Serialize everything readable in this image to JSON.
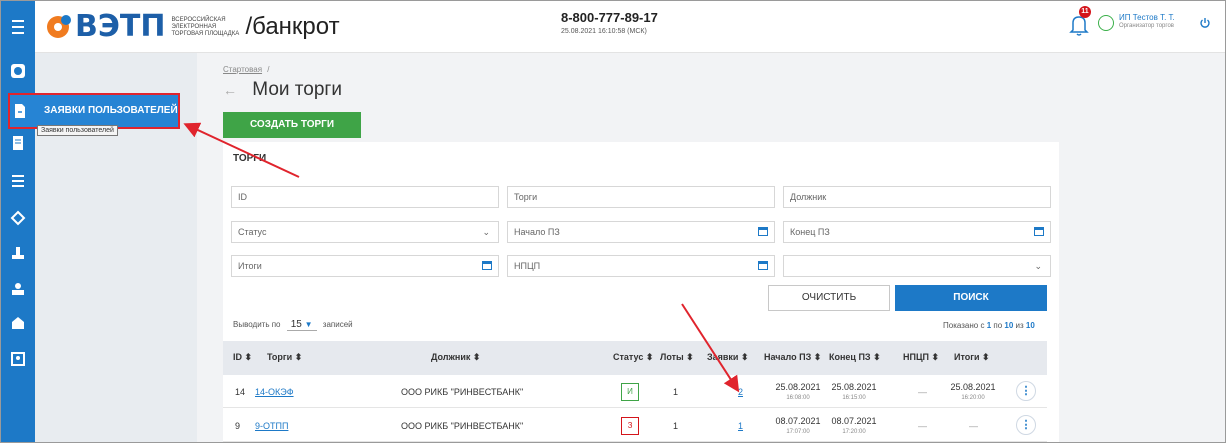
{
  "header": {
    "logo_word": "ВЭТП",
    "logo_sub_1": "Всероссийская",
    "logo_sub_2": "электронная",
    "logo_sub_3": "торговая площадка",
    "logo_suffix": "/банкрот",
    "phone": "8-800-777-89-17",
    "datetime": "25.08.2021 16:10:58 (МСК)",
    "notifications_count": "11",
    "user_name": "ИП Тестов Т. Т.",
    "user_role": "Организатор торгов"
  },
  "sidebar": {
    "icons": [
      "logo-icon",
      "file-icon",
      "document-icon",
      "list-icon",
      "gavel-icon",
      "auction-icon",
      "auction-alt-icon",
      "building-icon",
      "contacts-icon"
    ],
    "active_item_label": "ЗАЯВКИ ПОЛЬЗОВАТЕЛЕЙ",
    "tooltip": "Заявки пользователей"
  },
  "breadcrumb": {
    "home": "Стартовая",
    "separator": "/"
  },
  "page": {
    "back_icon": "arrow-left-icon",
    "title": "Мои торги",
    "create_button": "Создать торги"
  },
  "filters": {
    "section_title": "ТОРГИ",
    "id_placeholder": "ID",
    "torgi_placeholder": "Торги",
    "debtor_placeholder": "Должник",
    "status_placeholder": "Статус",
    "start_pz_placeholder": "Начало ПЗ",
    "end_pz_placeholder": "Конец ПЗ",
    "results_placeholder": "Итоги",
    "npcp_placeholder": "НПЦП",
    "clear_button": "ОЧИСТИТЬ",
    "search_button": "ПОИСК"
  },
  "table_controls": {
    "show_prefix": "Выводить по",
    "per_page": "15",
    "show_suffix": "записей",
    "shown_prefix": "Показано с",
    "shown_from": "1",
    "shown_mid": "по",
    "shown_to": "10",
    "shown_of": "из",
    "shown_total": "10"
  },
  "table": {
    "columns": [
      "ID ⬍",
      "Торги ⬍",
      "Должник ⬍",
      "Статус ⬍",
      "Лоты ⬍",
      "Заявки ⬍",
      "Начало ПЗ ⬍",
      "Конец ПЗ ⬍",
      "НПЦП ⬍",
      "Итоги ⬍"
    ],
    "rows": [
      {
        "id": "14",
        "torgi": "14-ОКЭФ",
        "debtor": "ООО РИКБ \"РИНВЕСТБАНК\"",
        "status": "И",
        "status_color": "#3fa447",
        "lots": "1",
        "bids": "2",
        "start_date": "25.08.2021",
        "start_time": "16:08:00",
        "end_date": "25.08.2021",
        "end_time": "16:15:00",
        "npcp": "—",
        "results_date": "25.08.2021",
        "results_time": "16:20:00"
      },
      {
        "id": "9",
        "torgi": "9-ОТПП",
        "debtor": "ООО РИКБ \"РИНВЕСТБАНК\"",
        "status": "З",
        "status_color": "#d4151b",
        "lots": "1",
        "bids": "1",
        "start_date": "08.07.2021",
        "start_time": "17:07:00",
        "end_date": "08.07.2021",
        "end_time": "17:20:00",
        "npcp": "—",
        "results": "—"
      }
    ]
  },
  "colors": {
    "brand_blue": "#1d79c7",
    "green": "#3fa447",
    "red_annotation": "#e0242d"
  }
}
